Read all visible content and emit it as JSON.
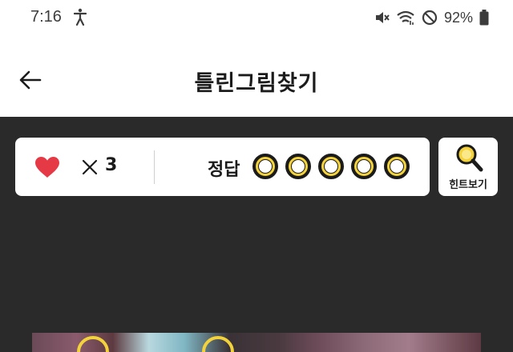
{
  "status_bar": {
    "time": "7:16",
    "battery": "92%",
    "icons": [
      "accessibility-icon",
      "mute-icon",
      "wifi-icon",
      "do-not-disturb-icon",
      "battery-icon"
    ]
  },
  "app_bar": {
    "title": "틀린그림찾기",
    "back_icon": "arrow-left-icon"
  },
  "game": {
    "lives_icon": "heart-icon",
    "lives_count": "3",
    "answer_label": "정답",
    "answers_total": 5,
    "answers_found": 0,
    "hint_label": "힌트보기",
    "hint_icon": "magnifier-icon"
  },
  "colors": {
    "accent_yellow": "#f3d23c",
    "heart_red": "#e63946",
    "game_background": "#2a2a2a"
  }
}
